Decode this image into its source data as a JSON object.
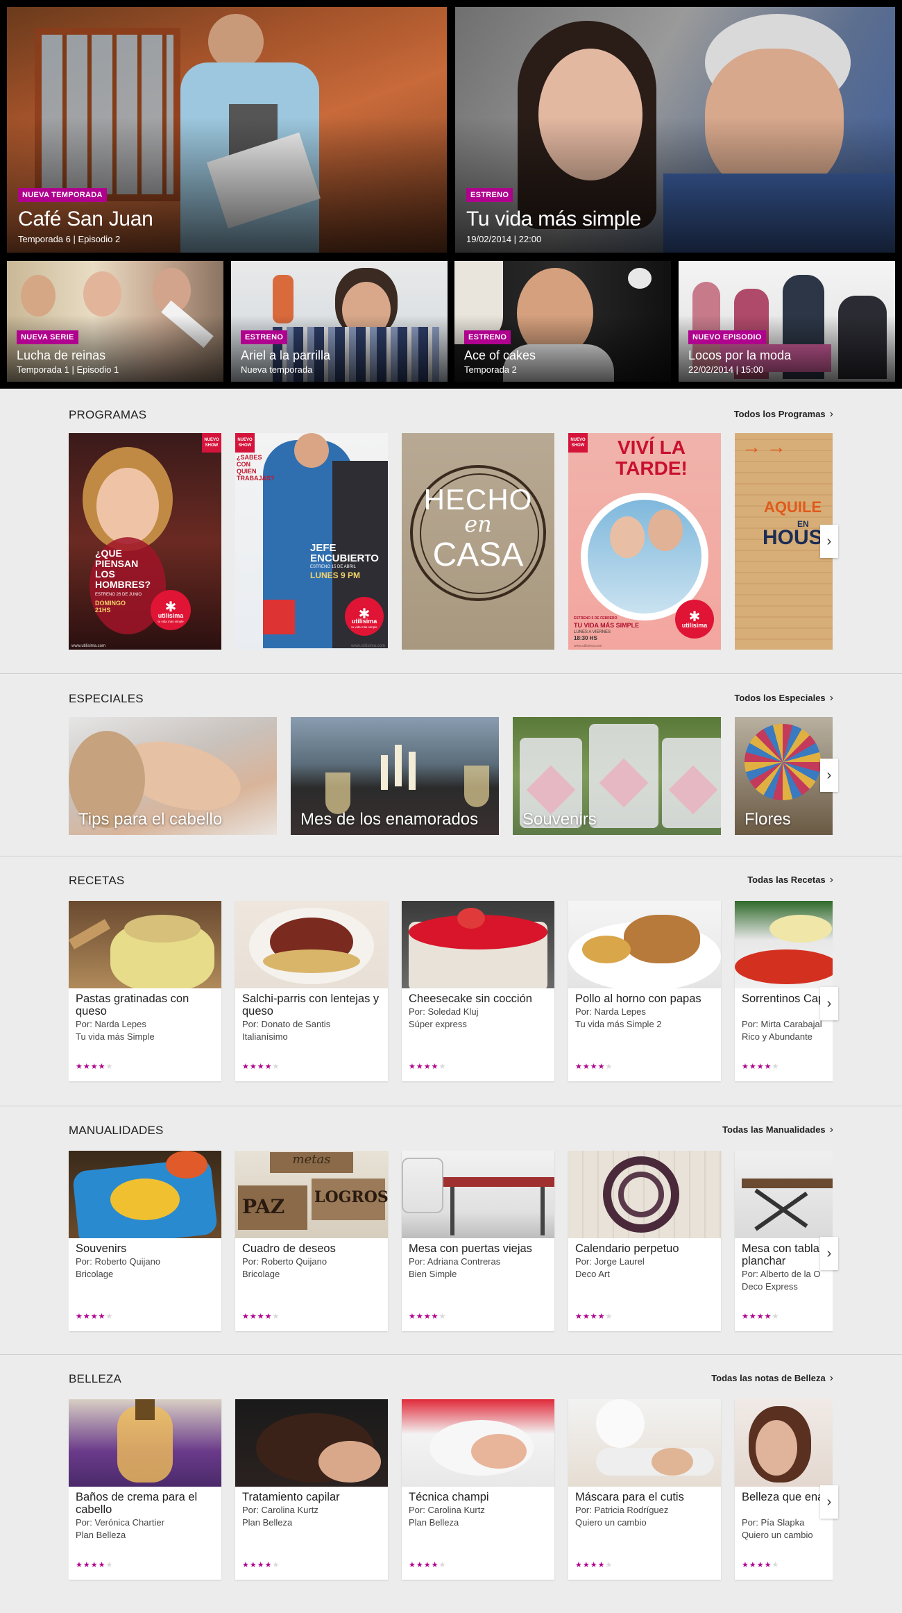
{
  "hero": {
    "featured": [
      {
        "badge": "NUEVA TEMPORADA",
        "title": "Café San Juan",
        "subtitle": "Temporada 6 | Episodio 2"
      },
      {
        "badge": "ESTRENO",
        "title": "Tu vida más simple",
        "subtitle": "19/02/2014 | 22:00"
      }
    ],
    "small": [
      {
        "badge": "NUEVA SERIE",
        "title": "Lucha de reinas",
        "subtitle": "Temporada 1 | Episodio 1"
      },
      {
        "badge": "ESTRENO",
        "title": "Ariel a la parrilla",
        "subtitle": "Nueva temporada"
      },
      {
        "badge": "ESTRENO",
        "title": "Ace of cakes",
        "subtitle": "Temporada 2"
      },
      {
        "badge": "NUEVO EPISODIO",
        "title": "Locos por la moda",
        "subtitle": "22/02/2014 | 15:00"
      }
    ]
  },
  "programas": {
    "title": "PROGRAMAS",
    "link": "Todos los Programas",
    "posters": [
      {
        "badge": "NUEVO SHOW",
        "headline": "¿QUE PIENSAN LOS HOMBRES?",
        "sub": "ESTRENO 26 DE JUNIO",
        "time": "DOMINGO 21HS",
        "logo": "utilisima",
        "logo_sub": "tu vida más simple",
        "footer": "www.utilisima.com"
      },
      {
        "badge": "NUEVO SHOW",
        "question": "¿SABES CON QUIEN TRABAJAS?",
        "headline": "JEFE ENCUBIERTO",
        "sub": "ESTRENO 15 DE ABRIL",
        "time": "LUNES 9 PM",
        "logo": "utilisima",
        "logo_sub": "tu vida más simple",
        "footer": "www.utilisima.com"
      },
      {
        "line1": "HECHO",
        "line2": "en",
        "line3": "CASA"
      },
      {
        "badge": "NUEVO SHOW",
        "headline": "VIVÍ LA TARDE!",
        "sub": "ESTRENO 5 DE FEBRERO",
        "slogan": "TU VIDA MÁS SIMPLE",
        "days": "LUNES A VIERNES",
        "time": "18:30 HS",
        "logo": "utilisima",
        "footer": "www.utilisima.com"
      },
      {
        "headline": "AQUILE",
        "headline2": "EN",
        "headline3": "HOUS"
      }
    ]
  },
  "especiales": {
    "title": "ESPECIALES",
    "link": "Todos los Especiales",
    "items": [
      {
        "label": "Tips para el cabello"
      },
      {
        "label": "Mes de los enamorados"
      },
      {
        "label": "Souvenirs"
      },
      {
        "label": "Flores"
      }
    ]
  },
  "recetas": {
    "title": "RECETAS",
    "link": "Todas las Recetas",
    "items": [
      {
        "title": "Pastas gratinadas con queso",
        "by": "Por: Narda Lepes",
        "show": "Tu vida más Simple",
        "rating": 4
      },
      {
        "title": "Salchi-parris con lentejas y queso",
        "by": "Por: Donato de Santis",
        "show": "Italianísimo",
        "rating": 4
      },
      {
        "title": "Cheesecake sin cocción",
        "by": "Por: Soledad Kluj",
        "show": "Súper express",
        "rating": 4
      },
      {
        "title": "Pollo al horno con papas",
        "by": "Por: Narda Lepes",
        "show": "Tu vida más Simple 2",
        "rating": 4
      },
      {
        "title": "Sorrentinos Capresse",
        "by": "Por: Mirta Carabajal",
        "show": "Rico y Abundante",
        "rating": 4
      }
    ]
  },
  "manualidades": {
    "title": "MANUALIDADES",
    "link": "Todas las Manualidades",
    "items": [
      {
        "title": "Souvenirs",
        "by": "Por: Roberto Quijano",
        "show": "Bricolage",
        "rating": 4
      },
      {
        "title": "Cuadro de deseos",
        "by": "Por: Roberto Quijano",
        "show": "Bricolage",
        "rating": 4
      },
      {
        "title": "Mesa con puertas viejas",
        "by": "Por: Adriana Contreras",
        "show": "Bien Simple",
        "rating": 4
      },
      {
        "title": "Calendario perpetuo",
        "by": "Por: Jorge Laurel",
        "show": "Deco Art",
        "rating": 4
      },
      {
        "title": "Mesa con tabla de planchar",
        "by": "Por: Alberto de la O",
        "show": "Deco Express",
        "rating": 4
      }
    ],
    "deco_words": {
      "top": "metas",
      "left": "PAZ",
      "right": "LOGROS"
    }
  },
  "belleza": {
    "title": "BELLEZA",
    "link": "Todas las notas de Belleza",
    "items": [
      {
        "title": "Baños de crema para el cabello",
        "by": "Por: Verónica Chartier",
        "show": "Plan Belleza",
        "rating": 4
      },
      {
        "title": "Tratamiento capilar",
        "by": "Por: Carolina Kurtz",
        "show": "Plan Belleza",
        "rating": 4
      },
      {
        "title": "Técnica champi",
        "by": "Por: Carolina Kurtz",
        "show": "Plan Belleza",
        "rating": 4
      },
      {
        "title": "Máscara para el cutis",
        "by": "Por: Patricia Rodríguez",
        "show": "Quiero un cambio",
        "rating": 4
      },
      {
        "title": "Belleza que enamora",
        "by": "Por: Pía Slapka",
        "show": "Quiero un cambio",
        "rating": 4
      }
    ]
  },
  "icons": {
    "chevron": "chevron-right-icon",
    "star": "star-icon"
  },
  "colors": {
    "accent": "#b0008e",
    "brand_red": "#e01434",
    "background": "#ececec"
  }
}
